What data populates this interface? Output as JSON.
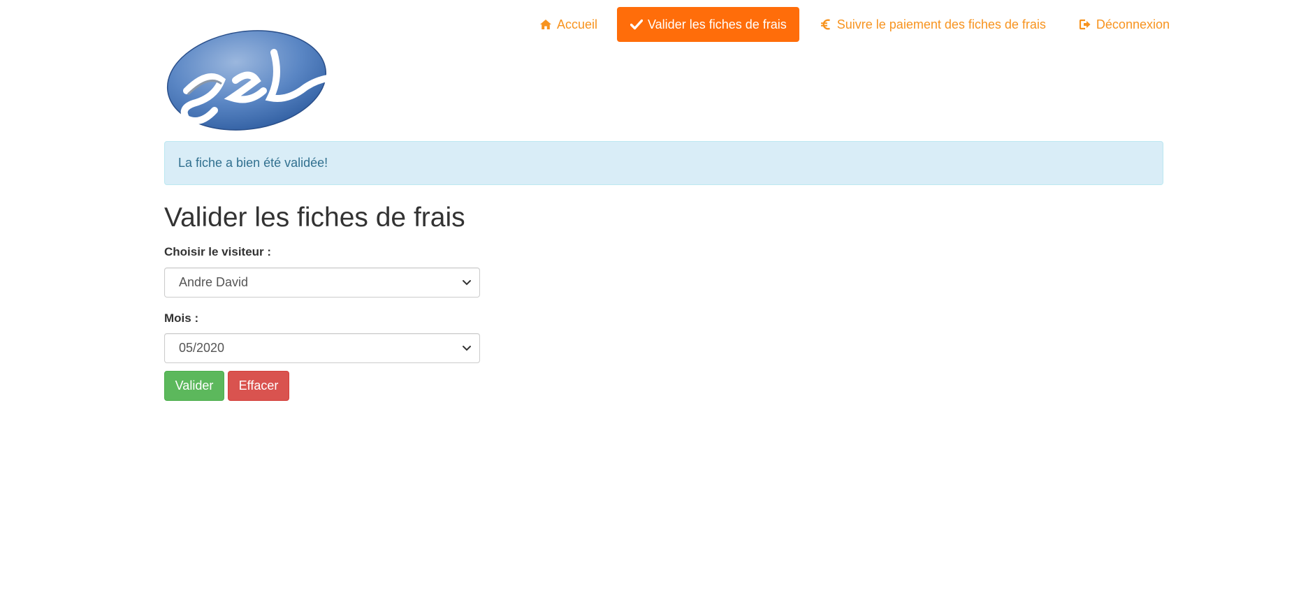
{
  "nav": {
    "items": [
      {
        "label": "Accueil",
        "icon": "home-icon",
        "active": false
      },
      {
        "label": "Valider les fiches de frais",
        "icon": "check-icon",
        "active": true
      },
      {
        "label": "Suivre le paiement des fiches de frais",
        "icon": "euro-icon",
        "active": false
      },
      {
        "label": "Déconnexion",
        "icon": "logout-icon",
        "active": false
      }
    ]
  },
  "logo": {
    "text": "gsb"
  },
  "alert": {
    "message": "La fiche a bien été validée!"
  },
  "main": {
    "title": "Valider les fiches de frais",
    "visitor_label": "Choisir le visiteur :",
    "visitor_value": "Andre David",
    "month_label": "Mois :",
    "month_value": "05/2020",
    "submit_label": "Valider",
    "reset_label": "Effacer"
  },
  "colors": {
    "accent": "#f7931e",
    "active_nav": "#ff6d0a",
    "alert_bg": "#d9edf7",
    "alert_text": "#31708f",
    "success": "#5cb85c",
    "danger": "#d9534f"
  }
}
